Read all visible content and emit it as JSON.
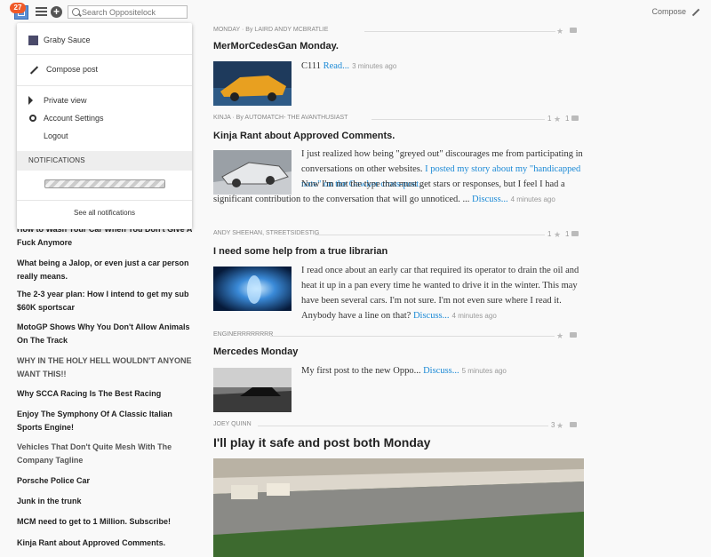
{
  "header": {
    "notification_count": "27",
    "search_placeholder": "Search Oppositelock",
    "compose_label": "Compose"
  },
  "dropdown": {
    "blog_name": "Graby Sauce",
    "compose_post": "Compose post",
    "private_view": "Private view",
    "account_settings": "Account Settings",
    "logout": "Logout",
    "notifications_heading": "NOTIFICATIONS",
    "see_all": "See all notifications"
  },
  "sidebar": {
    "items": [
      "How to Wash Your Car When You Don't Give A Fuck Anymore",
      "What being a Jalop, or even just a car person really means.",
      "The 2-3 year plan: How I intend to get my sub $60K sportscar",
      "MotoGP Shows Why You Don't Allow Animals On The Track",
      "WHY IN THE HOLY HELL WOULDN'T ANYONE WANT THIS!!",
      "Why SCCA Racing Is The Best Racing",
      "Enjoy The Symphony Of A Classic Italian Sports Engine!",
      "Vehicles That Don't Quite Mesh With The Company Tagline",
      "Porsche Police Car",
      "Junk in the trunk",
      "MCM need to get to 1 Million. Subscribe!",
      "Kinja Rant about Approved Comments."
    ]
  },
  "posts": [
    {
      "byline_a": "MONDAY",
      "byline_b": "· By LAIRD ANDY MCBRATLIE",
      "title": "MerMorCedesGan Monday.",
      "body": "C111",
      "read_more": "Read...",
      "time": "3 minutes ago"
    },
    {
      "byline_a": "KINJA",
      "byline_b": "· By AUTOMATCH- THE AVANTHUSIAST",
      "likes": "1",
      "replies": "1",
      "title": "Kinja Rant about Approved Comments.",
      "body_1": "I just realized how being \"greyed out\" discourages me from participating in conversations on other websites.",
      "link": "I posted my story about my \"handicapped note\" on the Gawker cross-post.",
      "body_2": "Now I'm not the type that must get stars or responses, but I feel I had a significant contribution to the conversation that will go unnoticed. ...",
      "discuss": "Discuss...",
      "time": "4 minutes ago"
    },
    {
      "byline_a": "ANDY SHEEHAN, STREETSIDESTIG",
      "likes": "1",
      "replies": "1",
      "title": "I need some help from a true librarian",
      "body": "I read once about an early car that required its operator to drain the oil and heat it up in a pan every time he wanted to drive it in the winter. This may have been several cars. I'm not sure. I'm not even sure where I read it. Anybody have a line on that?",
      "discuss": "Discuss...",
      "time": "4 minutes ago"
    },
    {
      "byline_a": "ENGINERRRRRRRR",
      "title": "Mercedes Monday",
      "body": "My first post to the new Oppo...",
      "discuss": "Discuss...",
      "time": "5 minutes ago"
    },
    {
      "byline_a": "JOEY QUINN",
      "likes": "3",
      "title": "I'll play it safe and post both Monday"
    }
  ],
  "colors": {
    "accent_link": "#1c8ad6",
    "badge": "#f05a28",
    "avatar_blue": "#5b8fd3"
  }
}
